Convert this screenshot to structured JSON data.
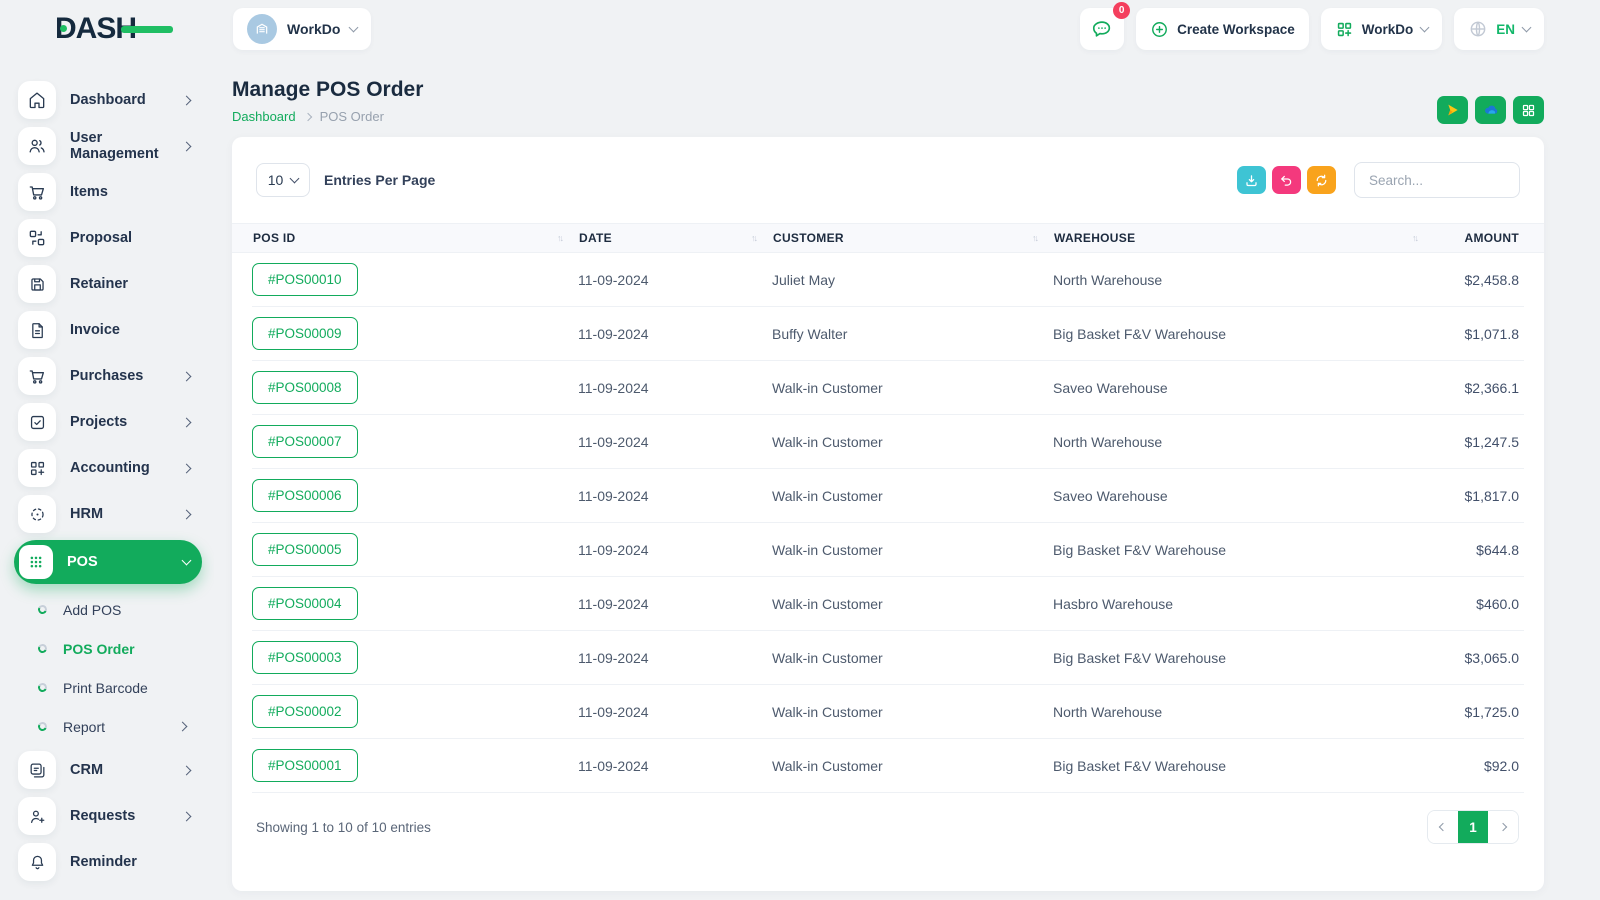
{
  "brand": {
    "logo_text": "DASH"
  },
  "header": {
    "workspace": {
      "label": "WorkDo",
      "icon": "building-avatar-icon"
    },
    "messages": {
      "icon": "chat-icon",
      "badge": "0"
    },
    "create_workspace": {
      "label": "Create Workspace",
      "icon": "plus-circle-icon"
    },
    "workdo_menu": {
      "label": "WorkDo",
      "icon": "grid-plus-icon"
    },
    "language": {
      "label": "EN",
      "icon": "globe-icon"
    }
  },
  "sidebar": {
    "items": [
      {
        "label": "Dashboard",
        "icon": "home-icon",
        "has_chevron": true
      },
      {
        "label": "User Management",
        "icon": "users-icon",
        "has_chevron": true
      },
      {
        "label": "Items",
        "icon": "cart-icon",
        "has_chevron": false
      },
      {
        "label": "Proposal",
        "icon": "swap-squares-icon",
        "has_chevron": false
      },
      {
        "label": "Retainer",
        "icon": "save-icon",
        "has_chevron": false
      },
      {
        "label": "Invoice",
        "icon": "file-invoice-icon",
        "has_chevron": false
      },
      {
        "label": "Purchases",
        "icon": "cart-icon",
        "has_chevron": true
      },
      {
        "label": "Projects",
        "icon": "check-square-icon",
        "has_chevron": true
      },
      {
        "label": "Accounting",
        "icon": "grid-plus-icon",
        "has_chevron": true
      },
      {
        "label": "HRM",
        "icon": "dashed-circle-icon",
        "has_chevron": true
      },
      {
        "label": "POS",
        "icon": "dots-grid-icon",
        "active": true,
        "has_chevron_down": true
      }
    ],
    "pos_children": [
      {
        "label": "Add POS"
      },
      {
        "label": "POS Order",
        "active": true
      },
      {
        "label": "Print Barcode"
      },
      {
        "label": "Report",
        "has_chevron": true
      }
    ],
    "items_tail": [
      {
        "label": "CRM",
        "icon": "chat-square-icon",
        "has_chevron": true
      },
      {
        "label": "Requests",
        "icon": "user-plus-icon",
        "has_chevron": true
      },
      {
        "label": "Reminder",
        "icon": "bell-icon",
        "has_chevron": false
      }
    ]
  },
  "page": {
    "title": "Manage POS Order",
    "breadcrumb_home": "Dashboard",
    "breadcrumb_current": "POS Order",
    "integrations": [
      {
        "icon": "drive-icon"
      },
      {
        "icon": "onedrive-cloud-icon"
      },
      {
        "icon": "grid-outline-icon"
      }
    ]
  },
  "toolbar": {
    "entries_value": "10",
    "entries_label": "Entries Per Page",
    "search_placeholder": "Search...",
    "actions": [
      {
        "icon": "download-icon",
        "color": "#3EC4D4"
      },
      {
        "icon": "undo-icon",
        "color": "#F4397D"
      },
      {
        "icon": "refresh-icon",
        "color": "#F9A31C"
      }
    ]
  },
  "table": {
    "columns": [
      "POS ID",
      "DATE",
      "CUSTOMER",
      "WAREHOUSE",
      "AMOUNT"
    ],
    "rows": [
      {
        "pos_id": "#POS00010",
        "date": "11-09-2024",
        "customer": "Juliet May",
        "warehouse": "North Warehouse",
        "amount": "$2,458.8"
      },
      {
        "pos_id": "#POS00009",
        "date": "11-09-2024",
        "customer": "Buffy Walter",
        "warehouse": "Big Basket F&V Warehouse",
        "amount": "$1,071.8"
      },
      {
        "pos_id": "#POS00008",
        "date": "11-09-2024",
        "customer": "Walk-in Customer",
        "warehouse": "Saveo Warehouse",
        "amount": "$2,366.1"
      },
      {
        "pos_id": "#POS00007",
        "date": "11-09-2024",
        "customer": "Walk-in Customer",
        "warehouse": "North Warehouse",
        "amount": "$1,247.5"
      },
      {
        "pos_id": "#POS00006",
        "date": "11-09-2024",
        "customer": "Walk-in Customer",
        "warehouse": "Saveo Warehouse",
        "amount": "$1,817.0"
      },
      {
        "pos_id": "#POS00005",
        "date": "11-09-2024",
        "customer": "Walk-in Customer",
        "warehouse": "Big Basket F&V Warehouse",
        "amount": "$644.8"
      },
      {
        "pos_id": "#POS00004",
        "date": "11-09-2024",
        "customer": "Walk-in Customer",
        "warehouse": "Hasbro Warehouse",
        "amount": "$460.0"
      },
      {
        "pos_id": "#POS00003",
        "date": "11-09-2024",
        "customer": "Walk-in Customer",
        "warehouse": "Big Basket F&V Warehouse",
        "amount": "$3,065.0"
      },
      {
        "pos_id": "#POS00002",
        "date": "11-09-2024",
        "customer": "Walk-in Customer",
        "warehouse": "North Warehouse",
        "amount": "$1,725.0"
      },
      {
        "pos_id": "#POS00001",
        "date": "11-09-2024",
        "customer": "Walk-in Customer",
        "warehouse": "Big Basket F&V Warehouse",
        "amount": "$92.0"
      }
    ],
    "footer": {
      "showing_text": "Showing 1 to 10 of 10 entries",
      "current_page": "1"
    }
  },
  "colors": {
    "primary_green": "#12AB5C",
    "teal": "#3EC4D4",
    "pink": "#F4397D",
    "orange": "#F9A31C",
    "badge_red": "#F43F5E",
    "dark_navy": "#1A2B3F",
    "background": "#F0F2F4"
  }
}
